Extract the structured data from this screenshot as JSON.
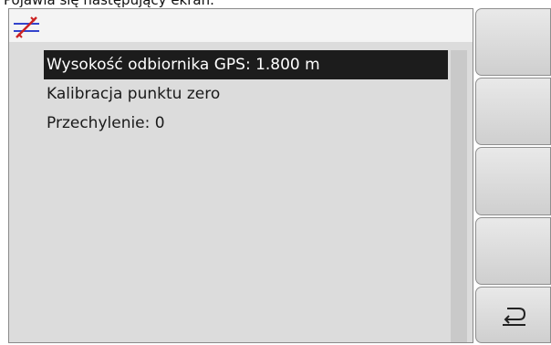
{
  "caption": "Pojawia się następujący ekran.",
  "header": {
    "icon": "gps-antenna-icon"
  },
  "menu": {
    "items": [
      {
        "label": "Wysokość odbiornika GPS: 1.800 m",
        "selected": true
      },
      {
        "label": "Kalibracja punktu zero",
        "selected": false
      },
      {
        "label": "Przechylenie: 0",
        "selected": false
      }
    ]
  },
  "softkeys": [
    {
      "icon": ""
    },
    {
      "icon": ""
    },
    {
      "icon": ""
    },
    {
      "icon": ""
    },
    {
      "icon": "return-icon"
    }
  ],
  "colors": {
    "selection": "#1c1c1c",
    "icon_blue": "#3344cc",
    "icon_red": "#cc2222"
  }
}
